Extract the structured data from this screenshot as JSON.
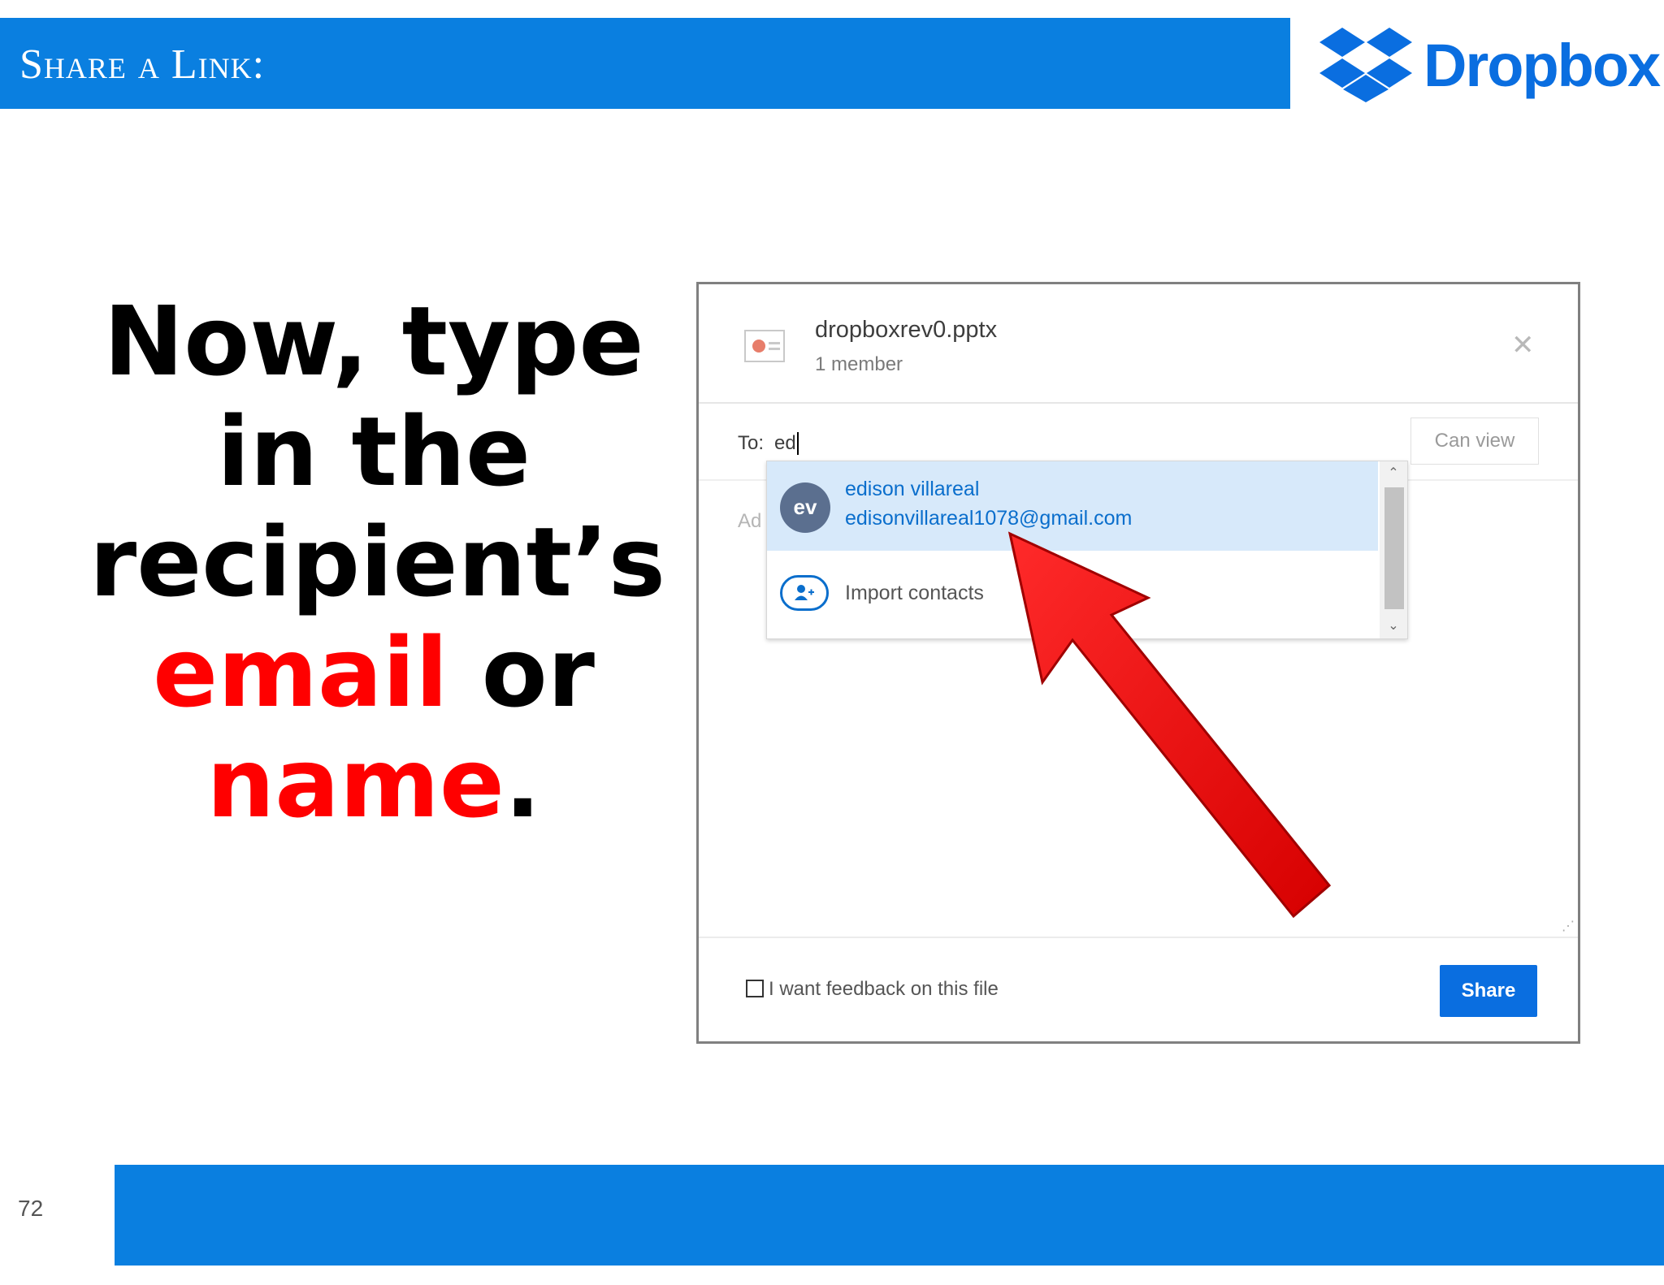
{
  "header": {
    "title": "Share a Link:",
    "logo_text": "Dropbox",
    "brand_color": "#0a7fe0"
  },
  "instruction": {
    "line1": "Now, type",
    "line2": "in the",
    "line3": "recipient’s",
    "email_word": "email",
    "or_word": " or",
    "name_word": "name",
    "period": ".",
    "highlight_color": "#ff0000"
  },
  "dialog": {
    "file_name": "dropboxrev0.pptx",
    "members": "1 member",
    "close_icon": "close-icon",
    "to_label": "To:",
    "to_value": "ed",
    "permission": "Can view",
    "message_placeholder": "Ad",
    "suggestion": {
      "initials": "ev",
      "name": "edison villareal",
      "email": "edisonvillareal1078@gmail.com"
    },
    "import_contacts": "Import contacts",
    "feedback_label": "I want feedback on this file",
    "share_button": "Share"
  },
  "footer": {
    "page_number": "72"
  }
}
